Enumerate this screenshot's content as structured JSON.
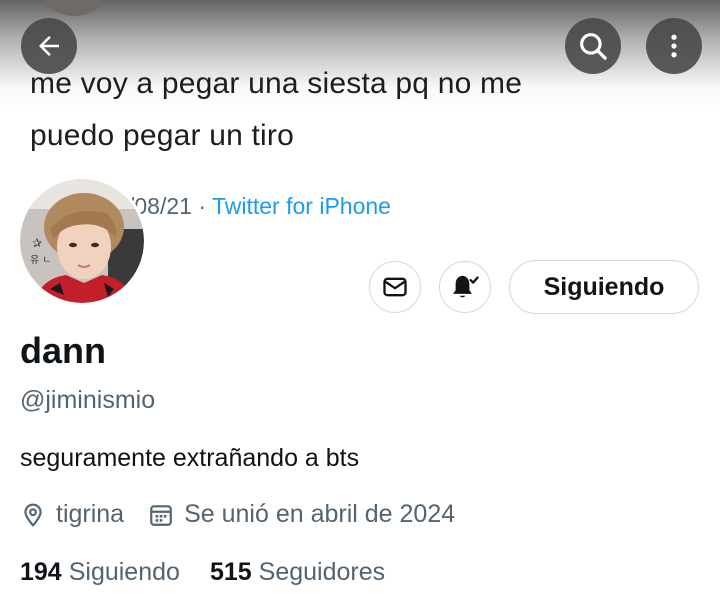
{
  "banner": {
    "tweet_text_line1": "me voy a pegar una siesta pq no me",
    "tweet_text_line2": "puedo pegar un tiro",
    "tweet_date_fragment": "/08/21 · ",
    "tweet_source": "Twitter for iPhone"
  },
  "nav": {
    "back_icon": "arrow-left-icon",
    "search_icon": "search-icon",
    "more_icon": "more-vertical-icon"
  },
  "actions": {
    "message_icon": "envelope-icon",
    "notifications_icon": "bell-check-icon",
    "follow_label": "Siguiendo"
  },
  "profile": {
    "display_name": "dann",
    "handle": "@jiminismio",
    "bio": "seguramente extrañando a bts",
    "location": "tigrina",
    "joined": "Se unió en abril de 2024"
  },
  "stats": {
    "following_count": "194",
    "following_label": "Siguiendo",
    "followers_count": "515",
    "followers_label": "Seguidores"
  },
  "colors": {
    "accent": "#1d9bf0",
    "secondary_text": "#536471",
    "primary_text": "#0f1419",
    "border": "#cfd9de"
  }
}
